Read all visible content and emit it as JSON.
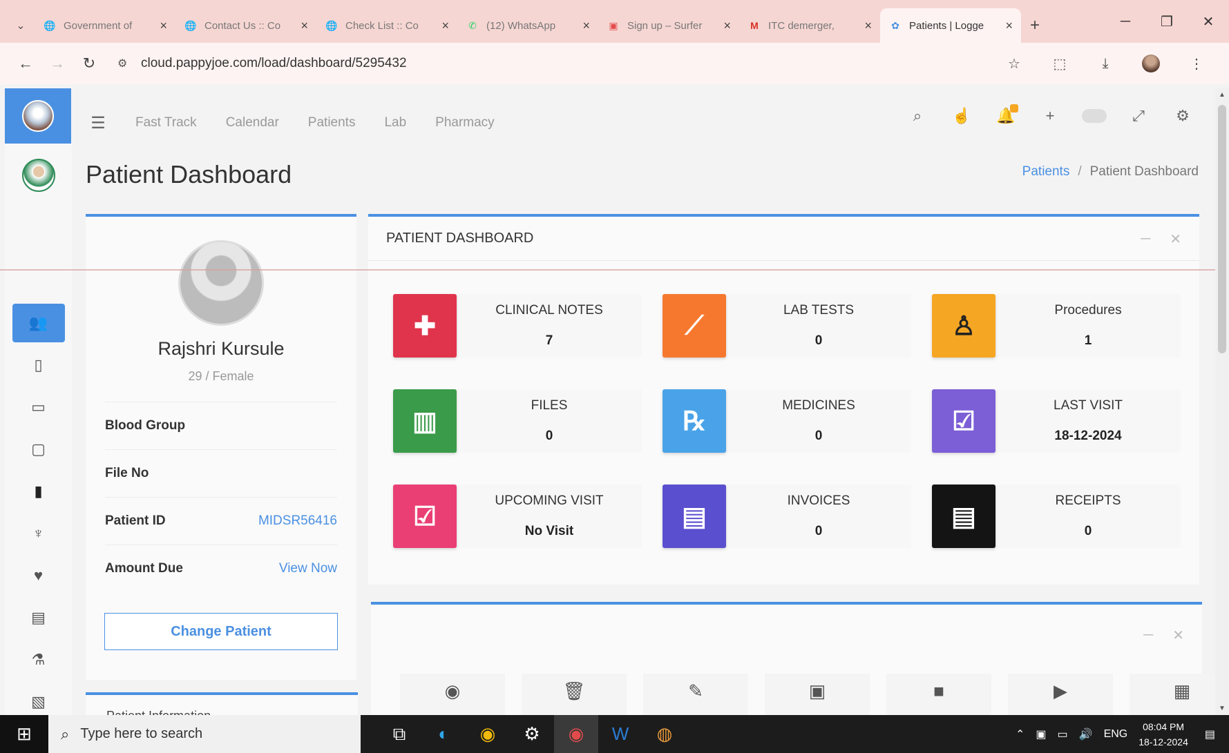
{
  "browser": {
    "tabs": [
      {
        "label": "Government of",
        "icon": "globe-icon"
      },
      {
        "label": "Contact Us :: Co",
        "icon": "globe-icon"
      },
      {
        "label": "Check List :: Co",
        "icon": "globe-icon"
      },
      {
        "label": "(12) WhatsApp",
        "icon": "whatsapp-icon"
      },
      {
        "label": "Sign up – Surfer",
        "icon": "surfer-icon"
      },
      {
        "label": "ITC demerger,",
        "icon": "gmail-icon"
      },
      {
        "label": "Patients | Logge",
        "icon": "pappyjoe-icon",
        "active": true
      }
    ],
    "url": "cloud.pappyjoe.com/load/dashboard/5295432"
  },
  "topnav": {
    "links": [
      "Fast Track",
      "Calendar",
      "Patients",
      "Lab",
      "Pharmacy"
    ]
  },
  "page": {
    "title": "Patient Dashboard",
    "breadcrumb": {
      "parent": "Patients",
      "current": "Patient Dashboard"
    }
  },
  "patient": {
    "name": "Rajshri Kursule",
    "age_gender": "29 / Female",
    "blood_group_label": "Blood Group",
    "blood_group_value": "",
    "file_no_label": "File No",
    "file_no_value": "",
    "patient_id_label": "Patient ID",
    "patient_id_value": "MIDSR56416",
    "amount_due_label": "Amount Due",
    "amount_due_link": "View Now",
    "change_button": "Change Patient",
    "info_section_title": "Patient Information"
  },
  "dashboard": {
    "header": "PATIENT DASHBOARD",
    "tiles": [
      {
        "label": "CLINICAL NOTES",
        "value": "7",
        "icon": "clipboard-plus-icon",
        "color": "#e0344c"
      },
      {
        "label": "LAB TESTS",
        "value": "0",
        "icon": "test-tube-icon",
        "color": "#f6782f"
      },
      {
        "label": "Procedures",
        "value": "1",
        "icon": "doctor-icon",
        "color": "#f5a623"
      },
      {
        "label": "FILES",
        "value": "0",
        "icon": "files-icon",
        "color": "#3a9b4a"
      },
      {
        "label": "MEDICINES",
        "value": "0",
        "icon": "prescription-icon",
        "color": "#4aa3e8"
      },
      {
        "label": "LAST VISIT",
        "value": "18-12-2024",
        "icon": "calendar-check-icon",
        "color": "#7c5ed6"
      },
      {
        "label": "UPCOMING VISIT",
        "value": "No Visit",
        "icon": "calendar-check-icon",
        "color": "#ea3f74"
      },
      {
        "label": "INVOICES",
        "value": "0",
        "icon": "invoice-icon",
        "color": "#5a4fcf"
      },
      {
        "label": "RECEIPTS",
        "value": "0",
        "icon": "receipt-icon",
        "color": "#141414"
      }
    ]
  },
  "taskbar": {
    "search_placeholder": "Type here to search",
    "lang": "ENG",
    "time": "08:04 PM",
    "date": "18-12-2024"
  }
}
